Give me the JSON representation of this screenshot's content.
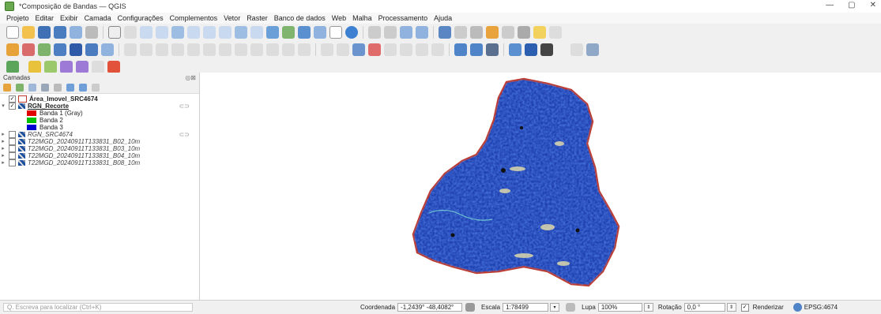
{
  "window": {
    "title": "*Composição de Bandas — QGIS",
    "minimize": "—",
    "restore": "▢",
    "close": "✕"
  },
  "menu": [
    "Projeto",
    "Editar",
    "Exibir",
    "Camada",
    "Configurações",
    "Complementos",
    "Vetor",
    "Raster",
    "Banco de dados",
    "Web",
    "Malha",
    "Processamento",
    "Ajuda"
  ],
  "layers_panel": {
    "title": "Camadas",
    "header_buttons": "◎⊠",
    "layers": [
      {
        "name": "Área_Imovel_SRC4674",
        "checked": true
      },
      {
        "name": "RGN_Recorte",
        "checked": true
      },
      {
        "name": "RGN_SRC4674",
        "checked": false
      },
      {
        "name": "T22MGD_20240911T133831_B02_10m",
        "checked": false
      },
      {
        "name": "T22MGD_20240911T133831_B03_10m",
        "checked": false
      },
      {
        "name": "T22MGD_20240911T133831_B04_10m",
        "checked": false
      },
      {
        "name": "T22MGD_20240911T133831_B08_10m",
        "checked": false
      }
    ],
    "bands": [
      {
        "label": "Banda 1 (Gray)",
        "color": "#e00000"
      },
      {
        "label": "Banda 2",
        "color": "#00c000"
      },
      {
        "label": "Banda 3",
        "color": "#0000d0"
      }
    ]
  },
  "statusbar": {
    "locate_placeholder": "Q. Escreva para localizar (Ctrl+K)",
    "coord_label": "Coordenada",
    "coord_value": "-1,2439° -48,4082°",
    "scale_label": "Escala",
    "scale_value": "1:78499",
    "magnifier_label": "Lupa",
    "magnifier_value": "100%",
    "rotation_label": "Rotação",
    "rotation_value": "0,0 °",
    "render_label": "Renderizar",
    "crs": "EPSG:4674"
  },
  "colors": {
    "raster_blue": "#1f3fb0",
    "outline_red": "#c0392b",
    "band_red": "#e00000",
    "band_green": "#00c000",
    "band_blue": "#0000d0"
  }
}
